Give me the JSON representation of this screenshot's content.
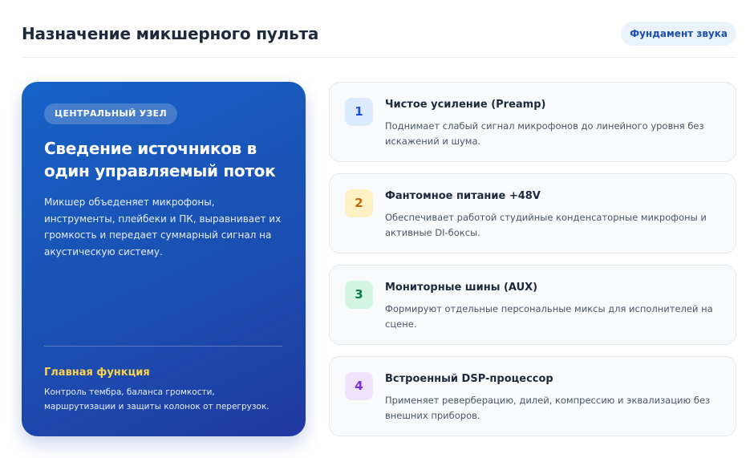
{
  "header": {
    "title": "Назначение микшерного пульта",
    "badge": "Фундамент звука"
  },
  "hero": {
    "tag": "ЦЕНТРАЛЬНЫЙ УЗЕЛ",
    "heading": "Сведение источников в один управляемый поток",
    "text": "Микшер объеденяет микрофоны, инструменты, плейбеки и ПК, выравнивает их громкость и передает суммарный сигнал на акустическую систему.",
    "footer_title": "Главная функция",
    "footer_text": "Контроль тембра, баланса громкости, маршрутизации и защиты колонок от перегрузок."
  },
  "cards": [
    {
      "number": "1",
      "title": "Чистое усиление (Preamp)",
      "description": "Поднимает слабый сигнал микрофонов до линейного уровня без искажений и шума.",
      "num_bg": "#dbeafe",
      "num_color": "#1d4ed8"
    },
    {
      "number": "2",
      "title": "Фантомное питание +48V",
      "description": "Обеспечивает работой студийные конденсаторные микрофоны и активные DI-боксы.",
      "num_bg": "#fdf0c2",
      "num_color": "#c2670a"
    },
    {
      "number": "3",
      "title": "Мониторные шины (AUX)",
      "description": "Формируют отдельные персональные миксы для исполнителей на сцене.",
      "num_bg": "#d3f5e3",
      "num_color": "#0f7a4b"
    },
    {
      "number": "4",
      "title": "Встроенный DSP-процессор",
      "description": "Применяет реверберацию, дилей, компрессию и эквализацию без внешних приборов.",
      "num_bg": "#efe3fd",
      "num_color": "#7c2fd6"
    }
  ]
}
